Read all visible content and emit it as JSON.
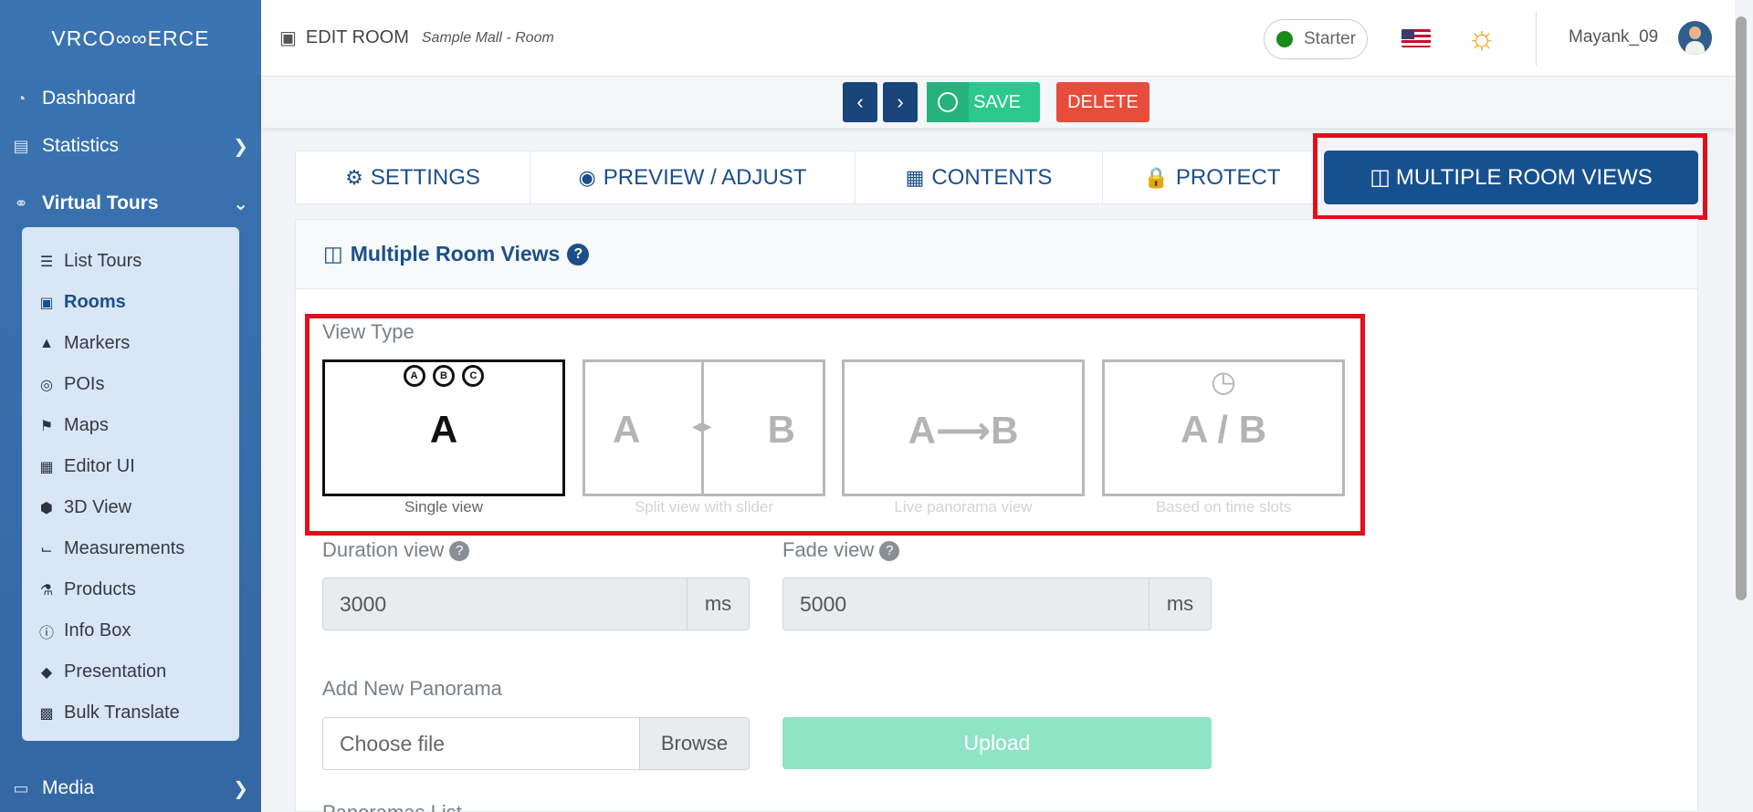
{
  "sidebar": {
    "logo": "VRCO∞∞ERCE",
    "items": [
      {
        "label": "Dashboard"
      },
      {
        "label": "Statistics"
      },
      {
        "label": "Virtual Tours"
      }
    ],
    "submenu": [
      {
        "label": "List Tours",
        "icon": "list-icon"
      },
      {
        "label": "Rooms",
        "icon": "vector-square-icon"
      },
      {
        "label": "Markers",
        "icon": "caret-square-up-icon"
      },
      {
        "label": "POIs",
        "icon": "bullseye-icon"
      },
      {
        "label": "Maps",
        "icon": "map-marked-icon"
      },
      {
        "label": "Editor UI",
        "icon": "swatchbook-icon"
      },
      {
        "label": "3D View",
        "icon": "cube-icon"
      },
      {
        "label": "Measurements",
        "icon": "ruler-icon"
      },
      {
        "label": "Products",
        "icon": "cart-icon"
      },
      {
        "label": "Info Box",
        "icon": "info-circle-icon"
      },
      {
        "label": "Presentation",
        "icon": "directions-icon"
      },
      {
        "label": "Bulk Translate",
        "icon": "language-icon"
      }
    ],
    "media_label": "Media"
  },
  "topbar": {
    "title": "EDIT ROOM",
    "subtitle": "Sample Mall - Room",
    "plan": "Starter",
    "username": "Mayank_09"
  },
  "actions": {
    "prev": "‹",
    "next": "›",
    "save": "SAVE",
    "delete": "DELETE"
  },
  "tabs": [
    {
      "label": "SETTINGS"
    },
    {
      "label": "PREVIEW / ADJUST"
    },
    {
      "label": "CONTENTS"
    },
    {
      "label": "PROTECT"
    },
    {
      "label": "MULTIPLE ROOM VIEWS"
    }
  ],
  "panel": {
    "title": "Multiple Room Views",
    "view_type_label": "View Type",
    "view_types": [
      {
        "caption": "Single view",
        "glyph": "A",
        "badges": [
          "A",
          "B",
          "C"
        ],
        "selected": true
      },
      {
        "caption": "Split view with slider",
        "glyph_left": "A",
        "glyph_right": "B"
      },
      {
        "caption": "Live panorama view",
        "glyph": "A⟶B"
      },
      {
        "caption": "Based on time slots",
        "glyph": "A / B"
      }
    ],
    "duration_label": "Duration view",
    "duration_value": "3000",
    "duration_unit": "ms",
    "fade_label": "Fade view",
    "fade_value": "5000",
    "fade_unit": "ms",
    "add_panorama_label": "Add New Panorama",
    "file_placeholder": "Choose file",
    "browse_label": "Browse",
    "upload_label": "Upload",
    "panoramas_list_label": "Panoramas List"
  },
  "colors": {
    "primary": "#17508e",
    "sidebar": "#3a74b2",
    "save": "#2cc88d",
    "delete": "#e74c3c",
    "highlight": "#e0101a"
  }
}
